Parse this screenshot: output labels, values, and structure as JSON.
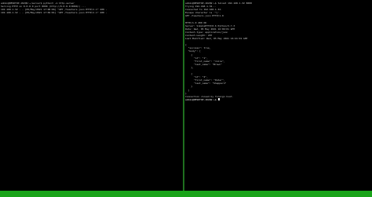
{
  "left_pane": {
    "lines": [
      "adm1n@DESKTOP-1K2Q9:~/server$ python3 -m http.server",
      "Serving HTTP on 0.0.0.0 port 8000 (http://0.0.0.0:8000/) ...",
      "192.168.1.32 - - [05/May/2021 17:08:06] \"GET /teachers.json HTTP/1.1\" 200 -",
      "192.168.1.32 - - [05/May/2021 17:09:01] \"GET /teachers.json HTTP/1.1\" 200 -"
    ]
  },
  "right_pane": {
    "lines": [
      "adm1n@DESKTOP-1K2Q9:~$ telnet 192.168.1.32 8000",
      "Trying 192.168.1.32...",
      "Connected to 192.168.1.32.",
      "Escape character is '^]'.",
      "GET /teachers.json HTTP/1.0",
      "",
      "HTTP/1.0 200 OK",
      "Server: SimpleHTTP/0.6 Python/3.7.3",
      "Date: Wed, 05 May 2021 16:09:01 GMT",
      "Content-type: application/json",
      "Content-Length: 207",
      "Last-Modified: Wed, 05 May 2021 16:21:01 GMT",
      "",
      "{",
      "  \"success\": true,",
      "  \"body\": [",
      "    {",
      "      \"id\": \"1\",",
      "      \"first_name\": \"Julia\",",
      "      \"last_name\": \"Brown\"",
      "    },",
      "",
      "    {",
      "      \"id\": \"2\",",
      "      \"first_name\": \"Peter\",",
      "      \"last_name\": \"Sheppard\"",
      "    }",
      "  ]",
      "}",
      "Connection closed by foreign host.",
      "adm1n@DESKTOP-1K2Q9:~$"
    ]
  },
  "status_bar": {
    "text": ""
  },
  "colors": {
    "background": "#000000",
    "text": "#c8c8c8",
    "status_bar": "#19a319",
    "divider": "#1f6f1f"
  }
}
